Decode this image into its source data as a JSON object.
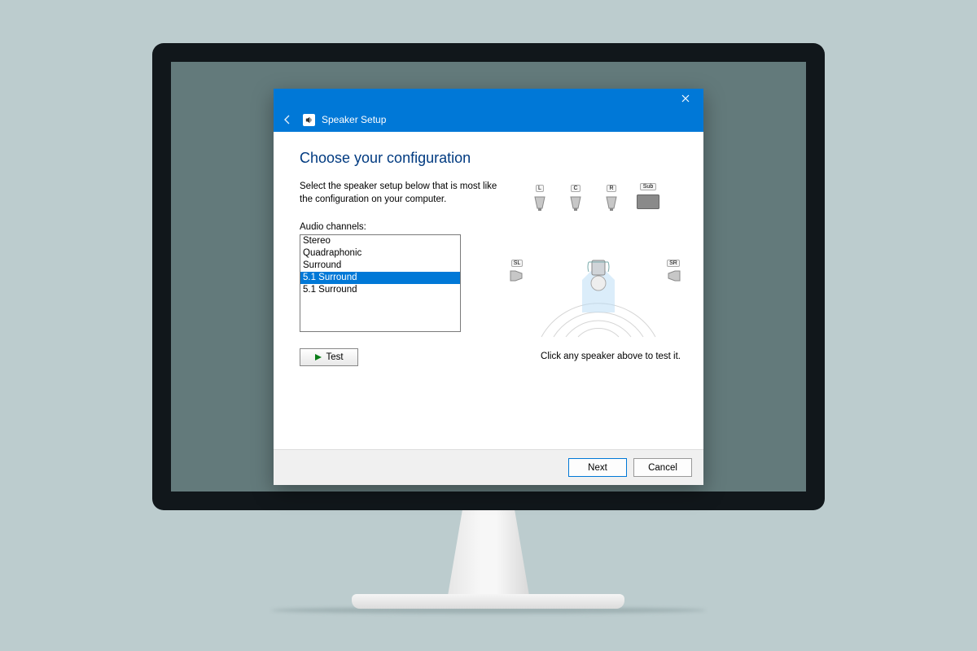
{
  "window": {
    "title": "Speaker Setup"
  },
  "heading": "Choose your configuration",
  "subtext_line1": "Select the speaker setup below that is most like",
  "subtext_line2": "the configuration on your computer.",
  "channels_label": "Audio channels:",
  "channels": {
    "items": [
      {
        "label": "Stereo"
      },
      {
        "label": "Quadraphonic"
      },
      {
        "label": "Surround"
      },
      {
        "label": "5.1 Surround"
      },
      {
        "label": "5.1 Surround"
      }
    ],
    "selected_index": 3
  },
  "test_button": "Test",
  "diagram": {
    "labels": {
      "left": "L",
      "center": "C",
      "right": "R",
      "sub": "Sub",
      "side_left": "SL",
      "side_right": "SR"
    },
    "note": "Click any speaker above to test it."
  },
  "footer": {
    "next": "Next",
    "cancel": "Cancel"
  },
  "colors": {
    "accent": "#0078d7"
  }
}
